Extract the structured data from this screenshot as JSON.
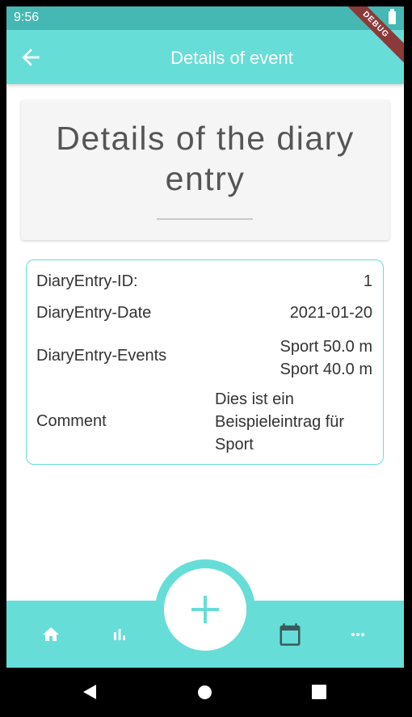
{
  "status_bar": {
    "time": "9:56"
  },
  "debug_banner": "DEBUG",
  "app_bar": {
    "title": "Details of event",
    "back_icon": "arrow-back-icon"
  },
  "header_card": {
    "title": "Details of the diary entry"
  },
  "details": {
    "id_label": "DiaryEntry-ID:",
    "id_value": "1",
    "date_label": "DiaryEntry-Date",
    "date_value": "2021-01-20",
    "events_label": "DiaryEntry-Events",
    "events": [
      "Sport 50.0 m",
      "Sport 40.0 m"
    ],
    "comment_label": "Comment",
    "comment_lines": [
      "Dies ist ein",
      "Beispieleintrag für",
      "Sport"
    ]
  },
  "bottom_nav": {
    "items": [
      "home-icon",
      "bar-chart-icon",
      "calendar-icon",
      "more-horiz-icon"
    ],
    "fab_icon": "add-icon"
  },
  "colors": {
    "accent": "#67ddd8",
    "status_bar": "#45b8b3",
    "debug": "#8b3a3a"
  }
}
